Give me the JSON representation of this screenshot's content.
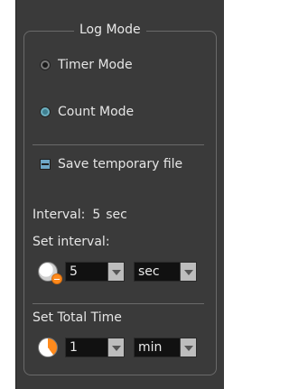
{
  "group": {
    "title": "Log Mode"
  },
  "mode": {
    "timer_label": "Timer Mode",
    "count_label": "Count Mode",
    "selected": "timer"
  },
  "save_temp": {
    "label": "Save temporary file",
    "checked": true
  },
  "interval": {
    "label": "Interval:",
    "value": "5",
    "unit": "sec",
    "set_label": "Set interval:",
    "select_value": "5",
    "unit_select_value": "sec"
  },
  "total_time": {
    "label": "Set Total Time",
    "select_value": "1",
    "unit_select_value": "min"
  },
  "colors": {
    "panel_bg": "#3a3a3a",
    "text": "#e6e6e6",
    "accent": "#ff8a1c"
  },
  "icons": {
    "interval_icon": "clock-with-minus-icon",
    "total_time_icon": "pie-clock-icon"
  }
}
